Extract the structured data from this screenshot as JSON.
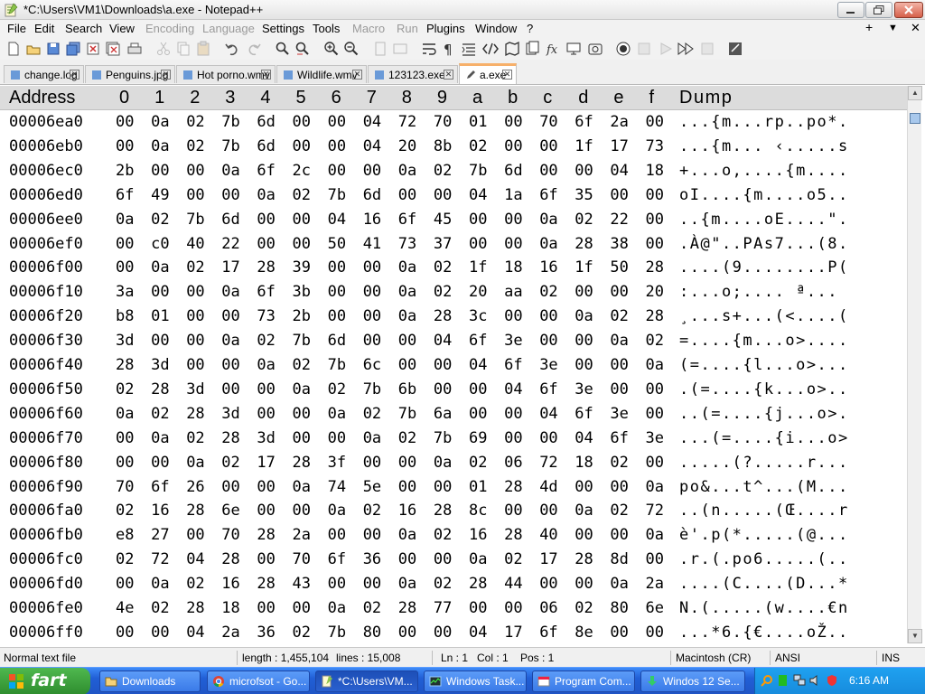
{
  "window": {
    "title": "*C:\\Users\\VM1\\Downloads\\a.exe - Notepad++"
  },
  "menu": {
    "items": [
      {
        "label": "File",
        "enabled": true
      },
      {
        "label": "Edit",
        "enabled": true
      },
      {
        "label": "Search",
        "enabled": true
      },
      {
        "label": "View",
        "enabled": true
      },
      {
        "label": "Encoding",
        "enabled": false
      },
      {
        "label": "Language",
        "enabled": false
      },
      {
        "label": "Settings",
        "enabled": true
      },
      {
        "label": "Tools",
        "enabled": true
      },
      {
        "label": "Macro",
        "enabled": false
      },
      {
        "label": "Run",
        "enabled": false
      },
      {
        "label": "Plugins",
        "enabled": true
      },
      {
        "label": "Window",
        "enabled": true
      },
      {
        "label": "?",
        "enabled": true
      }
    ],
    "right": [
      "+",
      "▼",
      "✕"
    ]
  },
  "tabs": [
    {
      "label": "change.log",
      "active": false
    },
    {
      "label": "Penguins.jpg",
      "active": false
    },
    {
      "label": "Hot porno.wmv",
      "active": false
    },
    {
      "label": "Wildlife.wmv",
      "active": false
    },
    {
      "label": "123123.exe",
      "active": false
    },
    {
      "label": "a.exe",
      "active": true
    }
  ],
  "hex": {
    "headers": [
      "Address",
      "0",
      "1",
      "2",
      "3",
      "4",
      "5",
      "6",
      "7",
      "8",
      "9",
      "a",
      "b",
      "c",
      "d",
      "e",
      "f",
      "Dump"
    ],
    "rows": [
      {
        "addr": "00006ea0",
        "bytes": [
          "00",
          "0a",
          "02",
          "7b",
          "6d",
          "00",
          "00",
          "04",
          "72",
          "70",
          "01",
          "00",
          "70",
          "6f",
          "2a",
          "00"
        ],
        "dump": "...{m...rp..po*."
      },
      {
        "addr": "00006eb0",
        "bytes": [
          "00",
          "0a",
          "02",
          "7b",
          "6d",
          "00",
          "00",
          "04",
          "20",
          "8b",
          "02",
          "00",
          "00",
          "1f",
          "17",
          "73"
        ],
        "dump": "...{m... ‹.....s"
      },
      {
        "addr": "00006ec0",
        "bytes": [
          "2b",
          "00",
          "00",
          "0a",
          "6f",
          "2c",
          "00",
          "00",
          "0a",
          "02",
          "7b",
          "6d",
          "00",
          "00",
          "04",
          "18"
        ],
        "dump": "+...o,....{m...."
      },
      {
        "addr": "00006ed0",
        "bytes": [
          "6f",
          "49",
          "00",
          "00",
          "0a",
          "02",
          "7b",
          "6d",
          "00",
          "00",
          "04",
          "1a",
          "6f",
          "35",
          "00",
          "00"
        ],
        "dump": "oI....{m....o5.."
      },
      {
        "addr": "00006ee0",
        "bytes": [
          "0a",
          "02",
          "7b",
          "6d",
          "00",
          "00",
          "04",
          "16",
          "6f",
          "45",
          "00",
          "00",
          "0a",
          "02",
          "22",
          "00"
        ],
        "dump": "..{m....oE....\"."
      },
      {
        "addr": "00006ef0",
        "bytes": [
          "00",
          "c0",
          "40",
          "22",
          "00",
          "00",
          "50",
          "41",
          "73",
          "37",
          "00",
          "00",
          "0a",
          "28",
          "38",
          "00"
        ],
        "dump": ".À@\"..PAs7...(8."
      },
      {
        "addr": "00006f00",
        "bytes": [
          "00",
          "0a",
          "02",
          "17",
          "28",
          "39",
          "00",
          "00",
          "0a",
          "02",
          "1f",
          "18",
          "16",
          "1f",
          "50",
          "28"
        ],
        "dump": "....(9........P("
      },
      {
        "addr": "00006f10",
        "bytes": [
          "3a",
          "00",
          "00",
          "0a",
          "6f",
          "3b",
          "00",
          "00",
          "0a",
          "02",
          "20",
          "aa",
          "02",
          "00",
          "00",
          "20"
        ],
        "dump": ":...o;.... ª... "
      },
      {
        "addr": "00006f20",
        "bytes": [
          "b8",
          "01",
          "00",
          "00",
          "73",
          "2b",
          "00",
          "00",
          "0a",
          "28",
          "3c",
          "00",
          "00",
          "0a",
          "02",
          "28"
        ],
        "dump": "¸...s+...(<....("
      },
      {
        "addr": "00006f30",
        "bytes": [
          "3d",
          "00",
          "00",
          "0a",
          "02",
          "7b",
          "6d",
          "00",
          "00",
          "04",
          "6f",
          "3e",
          "00",
          "00",
          "0a",
          "02"
        ],
        "dump": "=....{m...o>...."
      },
      {
        "addr": "00006f40",
        "bytes": [
          "28",
          "3d",
          "00",
          "00",
          "0a",
          "02",
          "7b",
          "6c",
          "00",
          "00",
          "04",
          "6f",
          "3e",
          "00",
          "00",
          "0a"
        ],
        "dump": "(=....{l...o>..."
      },
      {
        "addr": "00006f50",
        "bytes": [
          "02",
          "28",
          "3d",
          "00",
          "00",
          "0a",
          "02",
          "7b",
          "6b",
          "00",
          "00",
          "04",
          "6f",
          "3e",
          "00",
          "00"
        ],
        "dump": ".(=....{k...o>.."
      },
      {
        "addr": "00006f60",
        "bytes": [
          "0a",
          "02",
          "28",
          "3d",
          "00",
          "00",
          "0a",
          "02",
          "7b",
          "6a",
          "00",
          "00",
          "04",
          "6f",
          "3e",
          "00"
        ],
        "dump": "..(=....{j...o>."
      },
      {
        "addr": "00006f70",
        "bytes": [
          "00",
          "0a",
          "02",
          "28",
          "3d",
          "00",
          "00",
          "0a",
          "02",
          "7b",
          "69",
          "00",
          "00",
          "04",
          "6f",
          "3e"
        ],
        "dump": "...(=....{i...o>"
      },
      {
        "addr": "00006f80",
        "bytes": [
          "00",
          "00",
          "0a",
          "02",
          "17",
          "28",
          "3f",
          "00",
          "00",
          "0a",
          "02",
          "06",
          "72",
          "18",
          "02",
          "00"
        ],
        "dump": ".....(?.....r..."
      },
      {
        "addr": "00006f90",
        "bytes": [
          "70",
          "6f",
          "26",
          "00",
          "00",
          "0a",
          "74",
          "5e",
          "00",
          "00",
          "01",
          "28",
          "4d",
          "00",
          "00",
          "0a"
        ],
        "dump": "po&...t^...(M..."
      },
      {
        "addr": "00006fa0",
        "bytes": [
          "02",
          "16",
          "28",
          "6e",
          "00",
          "00",
          "0a",
          "02",
          "16",
          "28",
          "8c",
          "00",
          "00",
          "0a",
          "02",
          "72"
        ],
        "dump": "..(n.....(Œ....r"
      },
      {
        "addr": "00006fb0",
        "bytes": [
          "e8",
          "27",
          "00",
          "70",
          "28",
          "2a",
          "00",
          "00",
          "0a",
          "02",
          "16",
          "28",
          "40",
          "00",
          "00",
          "0a"
        ],
        "dump": "è'.p(*.....(@..."
      },
      {
        "addr": "00006fc0",
        "bytes": [
          "02",
          "72",
          "04",
          "28",
          "00",
          "70",
          "6f",
          "36",
          "00",
          "00",
          "0a",
          "02",
          "17",
          "28",
          "8d",
          "00"
        ],
        "dump": ".r.(.po6.....(.."
      },
      {
        "addr": "00006fd0",
        "bytes": [
          "00",
          "0a",
          "02",
          "16",
          "28",
          "43",
          "00",
          "00",
          "0a",
          "02",
          "28",
          "44",
          "00",
          "00",
          "0a",
          "2a"
        ],
        "dump": "....(C....(D...*"
      },
      {
        "addr": "00006fe0",
        "bytes": [
          "4e",
          "02",
          "28",
          "18",
          "00",
          "00",
          "0a",
          "02",
          "28",
          "77",
          "00",
          "00",
          "06",
          "02",
          "80",
          "6e"
        ],
        "dump": "N.(.....(w....€n"
      },
      {
        "addr": "00006ff0",
        "bytes": [
          "00",
          "00",
          "04",
          "2a",
          "36",
          "02",
          "7b",
          "80",
          "00",
          "00",
          "04",
          "17",
          "6f",
          "8e",
          "00",
          "00"
        ],
        "dump": "...*6.{€....oŽ.."
      }
    ]
  },
  "statusbar": {
    "type": "Normal text file",
    "length": "length : 1,455,104",
    "lines": "lines : 15,008",
    "ln": "Ln : 1",
    "col": "Col : 1",
    "pos": "Pos : 1",
    "eol": "Macintosh (CR)",
    "encoding": "ANSI",
    "mode": "INS"
  },
  "taskbar": {
    "start_label": "fart",
    "tasks": [
      {
        "label": "Downloads",
        "active": false
      },
      {
        "label": "microfsot - Go...",
        "active": false
      },
      {
        "label": "*C:\\Users\\VM...",
        "active": true
      },
      {
        "label": "Windows Task...",
        "active": false
      },
      {
        "label": "Program Com...",
        "active": false
      },
      {
        "label": "Windos 12 Se...",
        "active": false
      }
    ],
    "clock": "6:16 AM"
  },
  "colors": {
    "tab_active_accent": "#f7b06a",
    "taskbar_blue": "#245edb",
    "start_green": "#3a9c3a",
    "tray_blue": "#1a95e6"
  }
}
